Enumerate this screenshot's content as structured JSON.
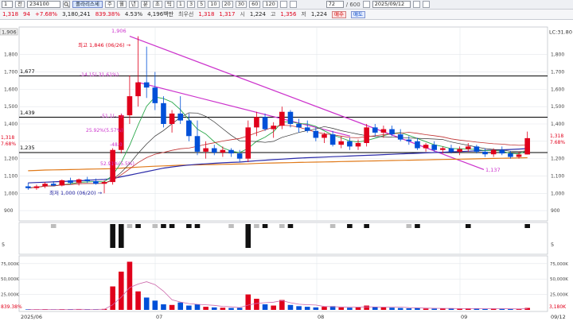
{
  "toolbar": {
    "period_input": "1",
    "tab_label": "전",
    "code_value": "234100",
    "stock_name": "폴라리스세",
    "period_buttons": [
      "주",
      "월",
      "년",
      "분",
      "초",
      "틱"
    ],
    "interval_buttons": [
      "1",
      "3",
      "5",
      "10",
      "20",
      "30",
      "60",
      "120"
    ],
    "count_value": "72",
    "count_total": "/ 600",
    "date_value": "2025/09/12"
  },
  "quote": {
    "price": "1,318",
    "change": "94",
    "rate": "+7.68%",
    "volume": "3,180,241",
    "vol_rate": "839.38%",
    "turnover": "4.53%",
    "amount": "4,196백만",
    "priority_label": "최우선",
    "ask": "1,318",
    "bid": "1,317",
    "open_label": "시",
    "open": "1,224",
    "high_label": "고",
    "high": "1,356",
    "low_label": "저",
    "low": "1,224",
    "buy_label": "매수",
    "sell_label": "매도"
  },
  "colors": {
    "up": "#e0001b",
    "down": "#0050d8",
    "trendline": "#cc33cc",
    "ma_long": "#2a2aa8",
    "ma_orange": "#e07a1a",
    "hline": "#000000"
  },
  "chart": {
    "left_top_label": "1,906",
    "right_top_label": "LC:31.80",
    "price_ticks": [
      "1,800",
      "1,700",
      "1,600",
      "1,500",
      "1,400",
      "1,300",
      "1,200",
      "1,100",
      "1,000",
      "900"
    ],
    "hline_labels": [
      "1,677",
      "1,439",
      "1,235"
    ],
    "right_price_tag": "1,318",
    "right_pct_tag": "7.68%",
    "left_price_tag": "1,318",
    "left_pct_tag": "7.68%",
    "annotations": {
      "peak": "1,906",
      "high_note": "최고 1,846 (06/26) →",
      "low_note": "최저 1,000 (06/20) →",
      "trend_end": "1,137",
      "pct1": "-14.15(-31.61%)",
      "pct2": "25.92%(5.57%)",
      "pct3": "52.91%(5.5%)",
      "pct4": "-51.1(-...)",
      "pct5": "-48.0"
    },
    "volume_ticks": [
      "75,000K",
      "50,000K",
      "25,000K"
    ],
    "volume_tag": "3,180K",
    "volume_pct": "839.38%",
    "osc_tick": "5",
    "dates": [
      "2025/06",
      "07",
      "08",
      "09",
      "09/12"
    ]
  },
  "chart_data": {
    "type": "candlestick",
    "series": [
      {
        "name": "",
        "ohlc": [
          [
            1040,
            1060,
            1020,
            1030
          ],
          [
            1030,
            1050,
            1020,
            1040
          ],
          [
            1040,
            1065,
            1030,
            1055
          ],
          [
            1055,
            1070,
            1040,
            1045
          ],
          [
            1045,
            1080,
            1040,
            1075
          ],
          [
            1075,
            1090,
            1050,
            1060
          ],
          [
            1060,
            1085,
            1045,
            1080
          ],
          [
            1080,
            1095,
            1060,
            1070
          ],
          [
            1070,
            1085,
            1050,
            1055
          ],
          [
            1055,
            1075,
            1000,
            1065
          ],
          [
            1065,
            1260,
            1050,
            1250
          ],
          [
            1250,
            1460,
            1230,
            1450
          ],
          [
            1450,
            1680,
            1400,
            1560
          ],
          [
            1560,
            1906,
            1500,
            1640
          ],
          [
            1640,
            1846,
            1550,
            1610
          ],
          [
            1610,
            1700,
            1480,
            1520
          ],
          [
            1520,
            1560,
            1380,
            1400
          ],
          [
            1400,
            1480,
            1350,
            1460
          ],
          [
            1460,
            1560,
            1400,
            1420
          ],
          [
            1420,
            1460,
            1300,
            1330
          ],
          [
            1330,
            1420,
            1220,
            1240
          ],
          [
            1240,
            1300,
            1200,
            1260
          ],
          [
            1260,
            1280,
            1220,
            1235
          ],
          [
            1235,
            1270,
            1210,
            1250
          ],
          [
            1250,
            1260,
            1210,
            1230
          ],
          [
            1230,
            1250,
            1180,
            1200
          ],
          [
            1200,
            1420,
            1180,
            1380
          ],
          [
            1380,
            1470,
            1330,
            1440
          ],
          [
            1440,
            1460,
            1360,
            1370
          ],
          [
            1370,
            1410,
            1320,
            1390
          ],
          [
            1390,
            1500,
            1370,
            1470
          ],
          [
            1470,
            1480,
            1380,
            1400
          ],
          [
            1400,
            1430,
            1350,
            1380
          ],
          [
            1380,
            1420,
            1350,
            1360
          ],
          [
            1360,
            1380,
            1300,
            1320
          ],
          [
            1320,
            1350,
            1290,
            1340
          ],
          [
            1340,
            1360,
            1270,
            1280
          ],
          [
            1280,
            1330,
            1260,
            1300
          ],
          [
            1300,
            1320,
            1250,
            1270
          ],
          [
            1270,
            1310,
            1250,
            1290
          ],
          [
            1290,
            1400,
            1270,
            1380
          ],
          [
            1380,
            1400,
            1330,
            1350
          ],
          [
            1350,
            1390,
            1320,
            1370
          ],
          [
            1370,
            1390,
            1330,
            1340
          ],
          [
            1340,
            1370,
            1300,
            1310
          ],
          [
            1310,
            1330,
            1280,
            1300
          ],
          [
            1300,
            1320,
            1250,
            1260
          ],
          [
            1260,
            1290,
            1240,
            1280
          ],
          [
            1280,
            1300,
            1240,
            1250
          ],
          [
            1250,
            1270,
            1230,
            1260
          ],
          [
            1260,
            1280,
            1230,
            1240
          ],
          [
            1240,
            1270,
            1220,
            1255
          ],
          [
            1255,
            1290,
            1240,
            1270
          ],
          [
            1270,
            1280,
            1230,
            1240
          ],
          [
            1240,
            1260,
            1210,
            1225
          ],
          [
            1225,
            1260,
            1210,
            1250
          ],
          [
            1250,
            1270,
            1220,
            1230
          ],
          [
            1230,
            1245,
            1200,
            1210
          ],
          [
            1210,
            1240,
            1200,
            1224
          ],
          [
            1224,
            1356,
            1224,
            1318
          ]
        ]
      }
    ],
    "ma_long": [
      1060,
      1062,
      1064,
      1066,
      1068,
      1070,
      1072,
      1075,
      1078,
      1080,
      1085,
      1095,
      1105,
      1115,
      1125,
      1135,
      1145,
      1152,
      1158,
      1163,
      1167,
      1170,
      1173,
      1176,
      1178,
      1180,
      1184,
      1188,
      1191,
      1194,
      1197,
      1200,
      1203,
      1205,
      1207,
      1209,
      1211,
      1213,
      1215,
      1217,
      1219,
      1221,
      1223,
      1225,
      1227,
      1229,
      1231,
      1233,
      1235,
      1237,
      1239,
      1241,
      1243,
      1245,
      1247,
      1249,
      1251,
      1253,
      1255,
      1258
    ],
    "ma_orange": [
      1130,
      1132,
      1134,
      1135,
      1136,
      1137,
      1138,
      1139,
      1140,
      1141,
      1142,
      1145,
      1148,
      1151,
      1154,
      1156,
      1158,
      1160,
      1162,
      1163,
      1164,
      1165,
      1166,
      1167,
      1168,
      1169,
      1170,
      1172,
      1174,
      1175,
      1176,
      1177,
      1178,
      1179,
      1180,
      1181,
      1182,
      1183,
      1184,
      1185,
      1186,
      1187,
      1188,
      1189,
      1190,
      1191,
      1192,
      1193,
      1194,
      1195,
      1196,
      1197,
      1198,
      1199,
      1200,
      1201,
      1202,
      1203,
      1204,
      1205
    ],
    "volume_k": [
      800,
      600,
      900,
      500,
      1200,
      700,
      900,
      600,
      500,
      1500,
      38000,
      62000,
      78000,
      30000,
      20000,
      15000,
      9000,
      8000,
      12000,
      7000,
      9000,
      5000,
      4000,
      3500,
      3000,
      3200,
      25000,
      18000,
      9000,
      7000,
      16000,
      8000,
      6000,
      5000,
      4000,
      5000,
      6000,
      4000,
      3500,
      4000,
      7000,
      5000,
      4000,
      3500,
      3000,
      2500,
      3000,
      2200,
      2000,
      2500,
      2000,
      1800,
      2200,
      2000,
      1500,
      2000,
      1800,
      1500,
      1200,
      3180
    ],
    "ylim": [
      850,
      1950
    ],
    "hlines": [
      1677,
      1439,
      1235
    ],
    "volume_ylim": [
      0,
      85000
    ]
  }
}
